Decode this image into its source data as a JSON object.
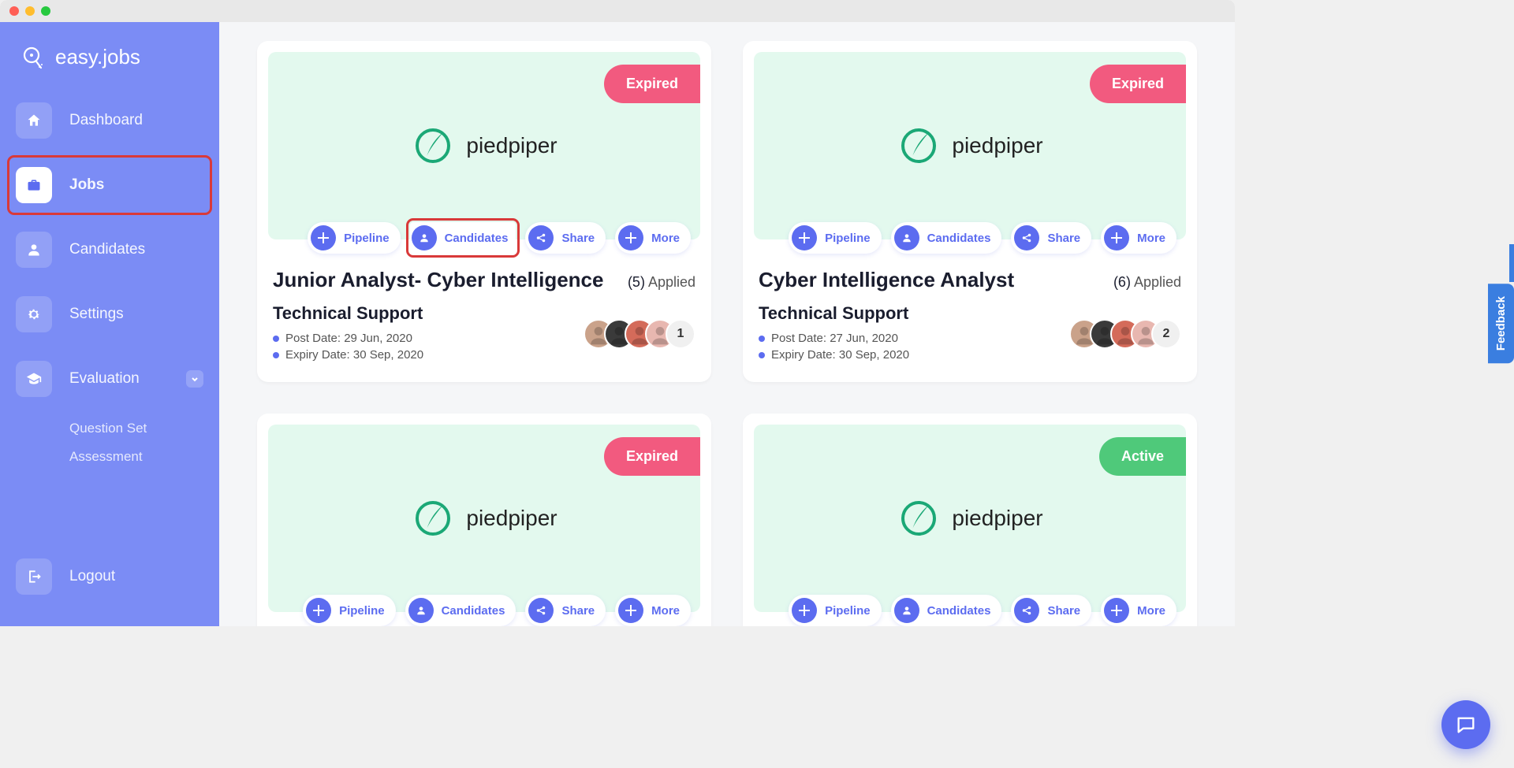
{
  "brand": {
    "name": "easy.jobs"
  },
  "sidebar": {
    "items": [
      {
        "label": "Dashboard"
      },
      {
        "label": "Jobs"
      },
      {
        "label": "Candidates"
      },
      {
        "label": "Settings"
      },
      {
        "label": "Evaluation"
      }
    ],
    "evaluation_children": [
      {
        "label": "Question Set"
      },
      {
        "label": "Assessment"
      }
    ],
    "logout": "Logout"
  },
  "actions": {
    "pipeline": "Pipeline",
    "candidates": "Candidates",
    "share": "Share",
    "more": "More"
  },
  "labels": {
    "applied": "Applied",
    "post_date": "Post Date:",
    "expiry_date": "Expiry Date:",
    "feedback": "Feedback"
  },
  "company": {
    "name": "piedpiper"
  },
  "jobs": [
    {
      "status": "Expired",
      "title": "Junior Analyst- Cyber Intelligence",
      "applied_count": "(5)",
      "department": "Technical Support",
      "post_date": "29 Jun, 2020",
      "expiry_date": "30 Sep, 2020",
      "extra_avatar_count": "1",
      "highlight_candidates": true
    },
    {
      "status": "Expired",
      "title": "Cyber Intelligence Analyst",
      "applied_count": "(6)",
      "department": "Technical Support",
      "post_date": "27 Jun, 2020",
      "expiry_date": "30 Sep, 2020",
      "extra_avatar_count": "2",
      "highlight_candidates": false
    },
    {
      "status": "Expired",
      "highlight_candidates": false
    },
    {
      "status": "Active",
      "highlight_candidates": false
    }
  ],
  "avatar_colors": [
    "#caa28a",
    "#3a3a3a",
    "#d46b5a",
    "#e8b7b0",
    "#e8e0d5"
  ]
}
